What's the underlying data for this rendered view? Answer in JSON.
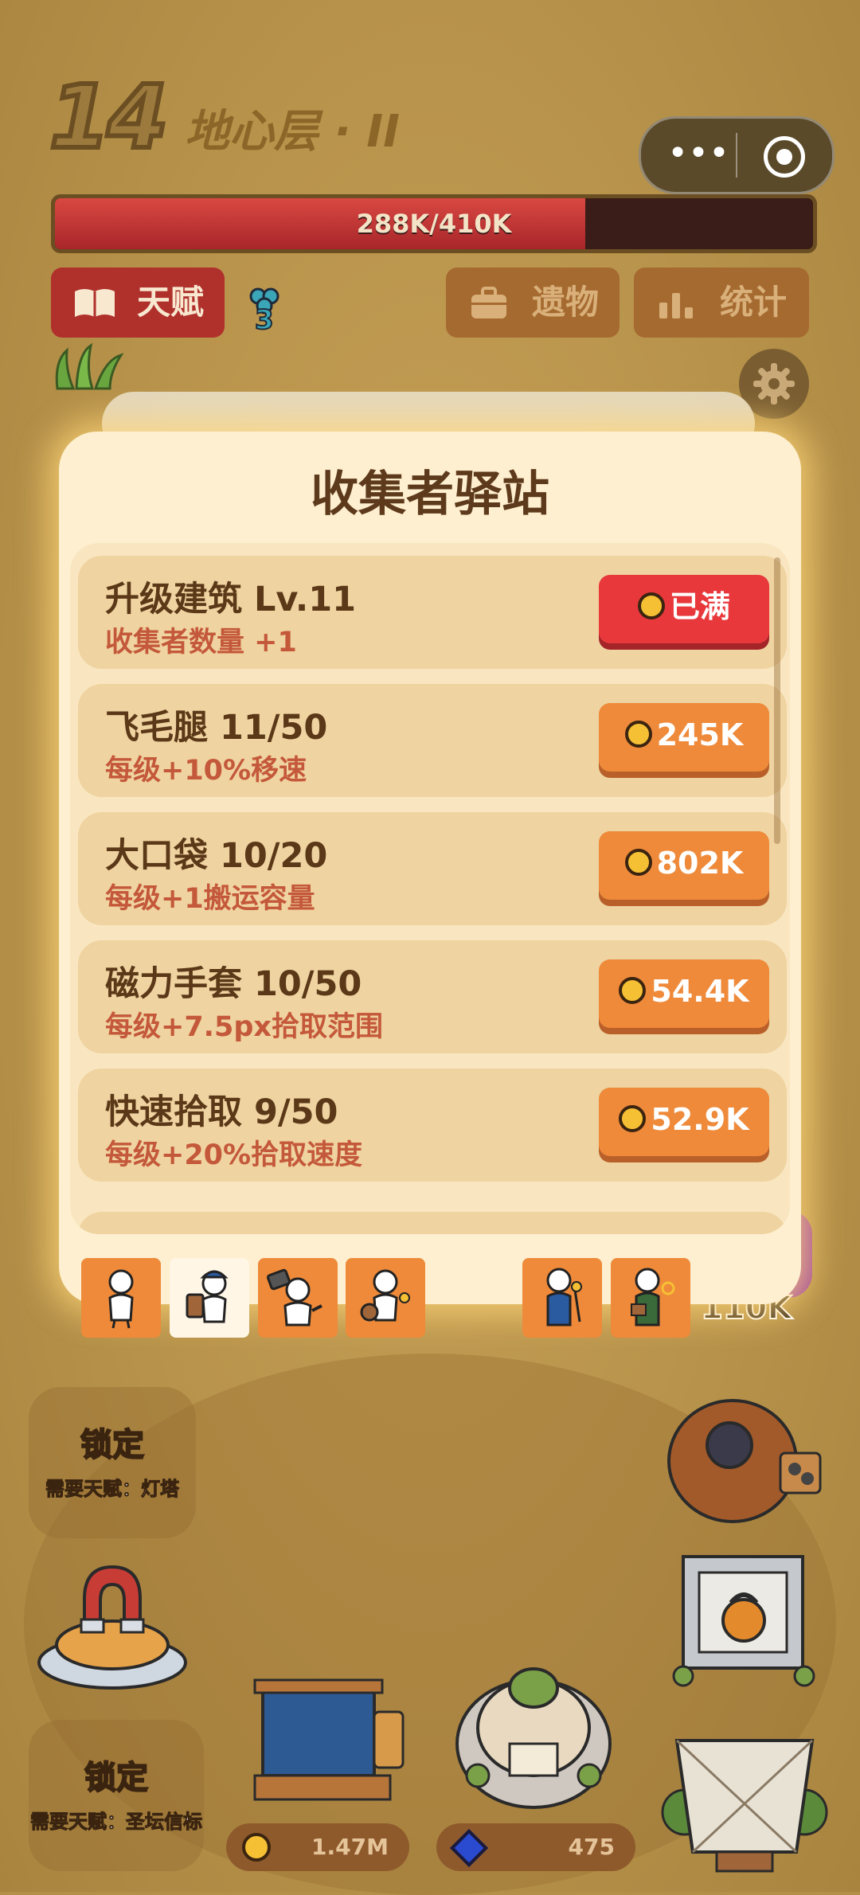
{
  "header": {
    "floor_number": "14",
    "floor_name": "地心层 · II",
    "progress_text": "288K/410K",
    "progress_fraction": 0.7
  },
  "toolbar": {
    "talent_label": "天赋",
    "talent_badge": "3",
    "relics_label": "遗物",
    "stats_label": "统计"
  },
  "modal": {
    "title": "收集者驿站",
    "items": [
      {
        "title": "升级建筑 Lv.11",
        "desc": "收集者数量 +1",
        "price": "已满",
        "style": "red"
      },
      {
        "title": "飞毛腿 11/50",
        "desc": "每级+10%移速",
        "price": "245K",
        "style": "orange"
      },
      {
        "title": "大口袋 10/20",
        "desc": "每级+1搬运容量",
        "price": "802K",
        "style": "orange"
      },
      {
        "title": "磁力手套 10/50",
        "desc": "每级+7.5px拾取范围",
        "price": "54.4K",
        "style": "orange"
      },
      {
        "title": "快速拾取 9/50",
        "desc": "每级+20%拾取速度",
        "price": "52.9K",
        "style": "orange"
      }
    ]
  },
  "buildings": {
    "locked_1_title": "锁定",
    "locked_1_sub": "需要天赋：灯塔",
    "locked_2_title": "锁定",
    "locked_2_sub": "需要天赋：圣坛信标",
    "partial_value": "110K"
  },
  "resources": {
    "gold": "1.47M",
    "gems": "475"
  },
  "colors": {
    "accent_red": "#e8383c",
    "accent_orange": "#ee8a3a",
    "panel": "#fdefcf",
    "title_brown": "#5e3a1c",
    "desc_red": "#c4583a"
  }
}
